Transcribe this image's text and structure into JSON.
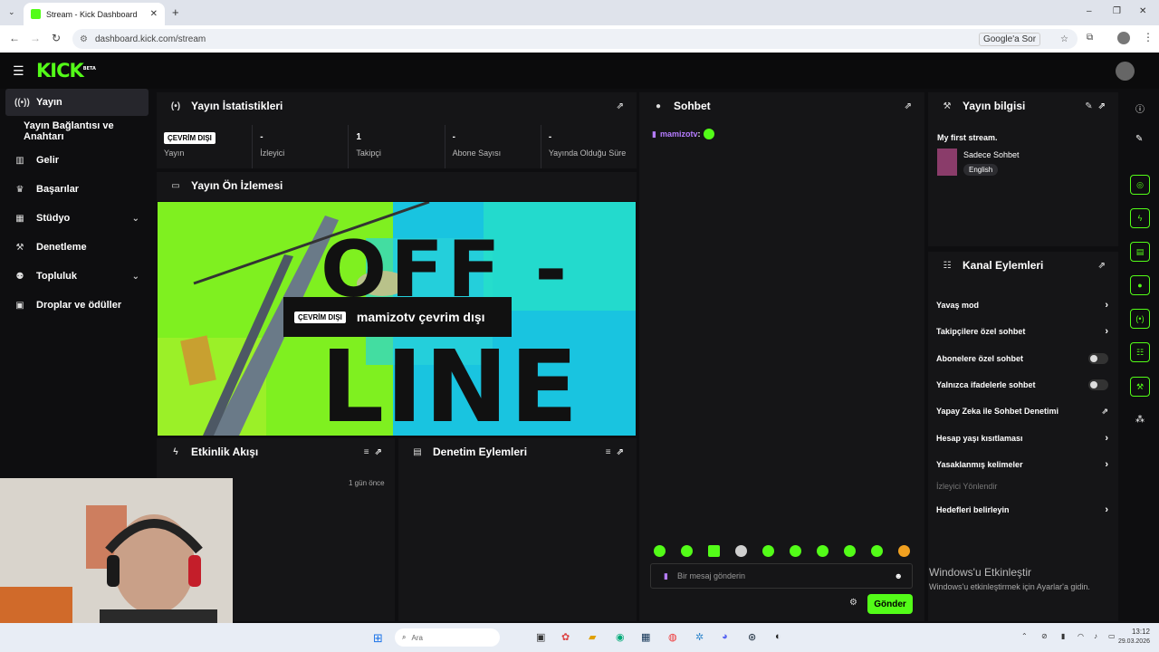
{
  "browser": {
    "tab_title": "Stream - Kick Dashboard",
    "url": "dashboard.kick.com/stream",
    "google_button": "Google'a Sor"
  },
  "header": {
    "logo": "KICK",
    "logo_tag": "BETA"
  },
  "sidebar": {
    "items": [
      {
        "label": "Yayın",
        "icon": "broadcast-icon"
      },
      {
        "label": "Yayın Bağlantısı ve Anahtarı",
        "icon": "none"
      },
      {
        "label": "Gelir",
        "icon": "chart-icon"
      },
      {
        "label": "Başarılar",
        "icon": "trophy-icon"
      },
      {
        "label": "Stüdyo",
        "icon": "grid-icon"
      },
      {
        "label": "Denetleme",
        "icon": "wrench-icon"
      },
      {
        "label": "Topluluk",
        "icon": "people-icon"
      },
      {
        "label": "Droplar ve ödüller",
        "icon": "gift-icon"
      }
    ]
  },
  "stats_panel": {
    "title": "Yayın İstatistikleri",
    "status_badge": "ÇEVRİM DIŞI",
    "stats": [
      {
        "value": "",
        "label": "Yayın"
      },
      {
        "value": "-",
        "label": "İzleyici"
      },
      {
        "value": "1",
        "label": "Takipçi"
      },
      {
        "value": "-",
        "label": "Abone Sayısı"
      },
      {
        "value": "-",
        "label": "Yayında Olduğu Süre"
      }
    ]
  },
  "preview_panel": {
    "title": "Yayın Ön İzlemesi",
    "offline_badge": "ÇEVRİM DIŞI",
    "offline_text": "mamizotv çevrim dışı",
    "bg_text_top": "OFF -",
    "bg_text_bottom": "LINE"
  },
  "activity_panel": {
    "title": "Etkinlik Akışı",
    "time": "1 gün önce"
  },
  "moderation_panel": {
    "title": "Denetim Eylemleri"
  },
  "chat": {
    "title": "Sohbet",
    "message_user": "mamizotv",
    "input_placeholder": "Bir mesaj gönderin",
    "send_label": "Gönder"
  },
  "stream_info": {
    "title": "Yayın bilgisi",
    "stream_title": "My first stream.",
    "category": "Sadece Sohbet",
    "language": "English"
  },
  "channel_actions": {
    "title": "Kanal Eylemleri",
    "rows": [
      {
        "label": "Yavaş mod",
        "type": "arrow"
      },
      {
        "label": "Takipçilere özel sohbet",
        "type": "arrow"
      },
      {
        "label": "Abonelere özel sohbet",
        "type": "toggle"
      },
      {
        "label": "Yalnızca ifadelerle sohbet",
        "type": "toggle"
      },
      {
        "label": "Yapay Zeka ile Sohbet Denetimi",
        "type": "external"
      },
      {
        "label": "Hesap yaşı kısıtlaması",
        "type": "arrow"
      },
      {
        "label": "Yasaklanmış kelimeler",
        "type": "arrow"
      }
    ],
    "section_label": "İzleyici Yönlendir",
    "goals_label": "Hedefleri belirleyin"
  },
  "windows": {
    "watermark_title": "Windows'u Etkinleştir",
    "watermark_sub": "Windows'u etkinleştirmek için Ayarlar'a gidin.",
    "search_placeholder": "Ara",
    "time": "13:12",
    "date": "29.03.2026"
  },
  "colors": {
    "accent": "#53fc18",
    "bg": "#0e0e10",
    "panel": "#151517"
  }
}
